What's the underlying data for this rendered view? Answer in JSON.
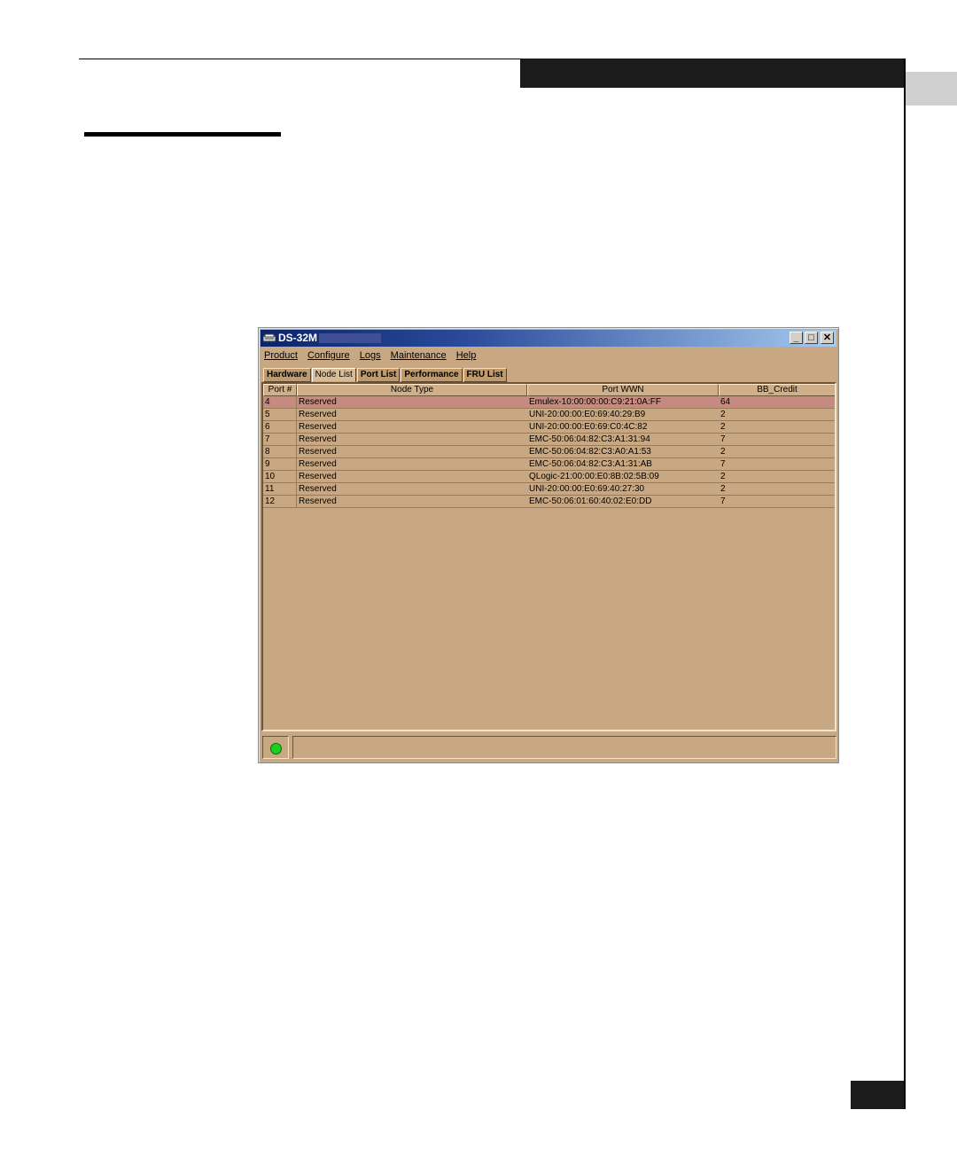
{
  "window": {
    "title": "DS-32M",
    "min_label": "_",
    "max_label": "□",
    "close_label": "✕"
  },
  "menu": [
    "Product",
    "Configure",
    "Logs",
    "Maintenance",
    "Help"
  ],
  "tabs": [
    {
      "label": "Hardware",
      "active": false
    },
    {
      "label": "Node List",
      "active": true
    },
    {
      "label": "Port List",
      "active": false
    },
    {
      "label": "Performance",
      "active": false
    },
    {
      "label": "FRU List",
      "active": false
    }
  ],
  "table": {
    "columns": [
      "Port #",
      "Node Type",
      "Port WWN",
      "BB_Credit"
    ],
    "rows": [
      {
        "port": "4",
        "type": "Reserved",
        "wwn": "Emulex-10:00:00:00:C9:21:0A:FF",
        "bb": "64",
        "selected": true
      },
      {
        "port": "5",
        "type": "Reserved",
        "wwn": "UNI-20:00:00:E0:69:40:29:B9",
        "bb": "2",
        "selected": false
      },
      {
        "port": "6",
        "type": "Reserved",
        "wwn": "UNI-20:00:00:E0:69:C0:4C:82",
        "bb": "2",
        "selected": false
      },
      {
        "port": "7",
        "type": "Reserved",
        "wwn": "EMC-50:06:04:82:C3:A1:31:94",
        "bb": "7",
        "selected": false
      },
      {
        "port": "8",
        "type": "Reserved",
        "wwn": "EMC-50:06:04:82:C3:A0:A1:53",
        "bb": "2",
        "selected": false
      },
      {
        "port": "9",
        "type": "Reserved",
        "wwn": "EMC-50:06:04:82:C3:A1:31:AB",
        "bb": "7",
        "selected": false
      },
      {
        "port": "10",
        "type": "Reserved",
        "wwn": "QLogic-21:00:00:E0:8B:02:5B:09",
        "bb": "2",
        "selected": false
      },
      {
        "port": "11",
        "type": "Reserved",
        "wwn": "UNI-20:00:00:E0:69:40:27:30",
        "bb": "2",
        "selected": false
      },
      {
        "port": "12",
        "type": "Reserved",
        "wwn": "EMC-50:06:01:60:40:02:E0:DD",
        "bb": "7",
        "selected": false
      }
    ]
  },
  "status": {
    "led_color": "#1ed01e",
    "message": ""
  },
  "colors": {
    "window_bg": "#c8a883",
    "selected_row": "#c58a80",
    "titlebar": "#0a246a"
  }
}
